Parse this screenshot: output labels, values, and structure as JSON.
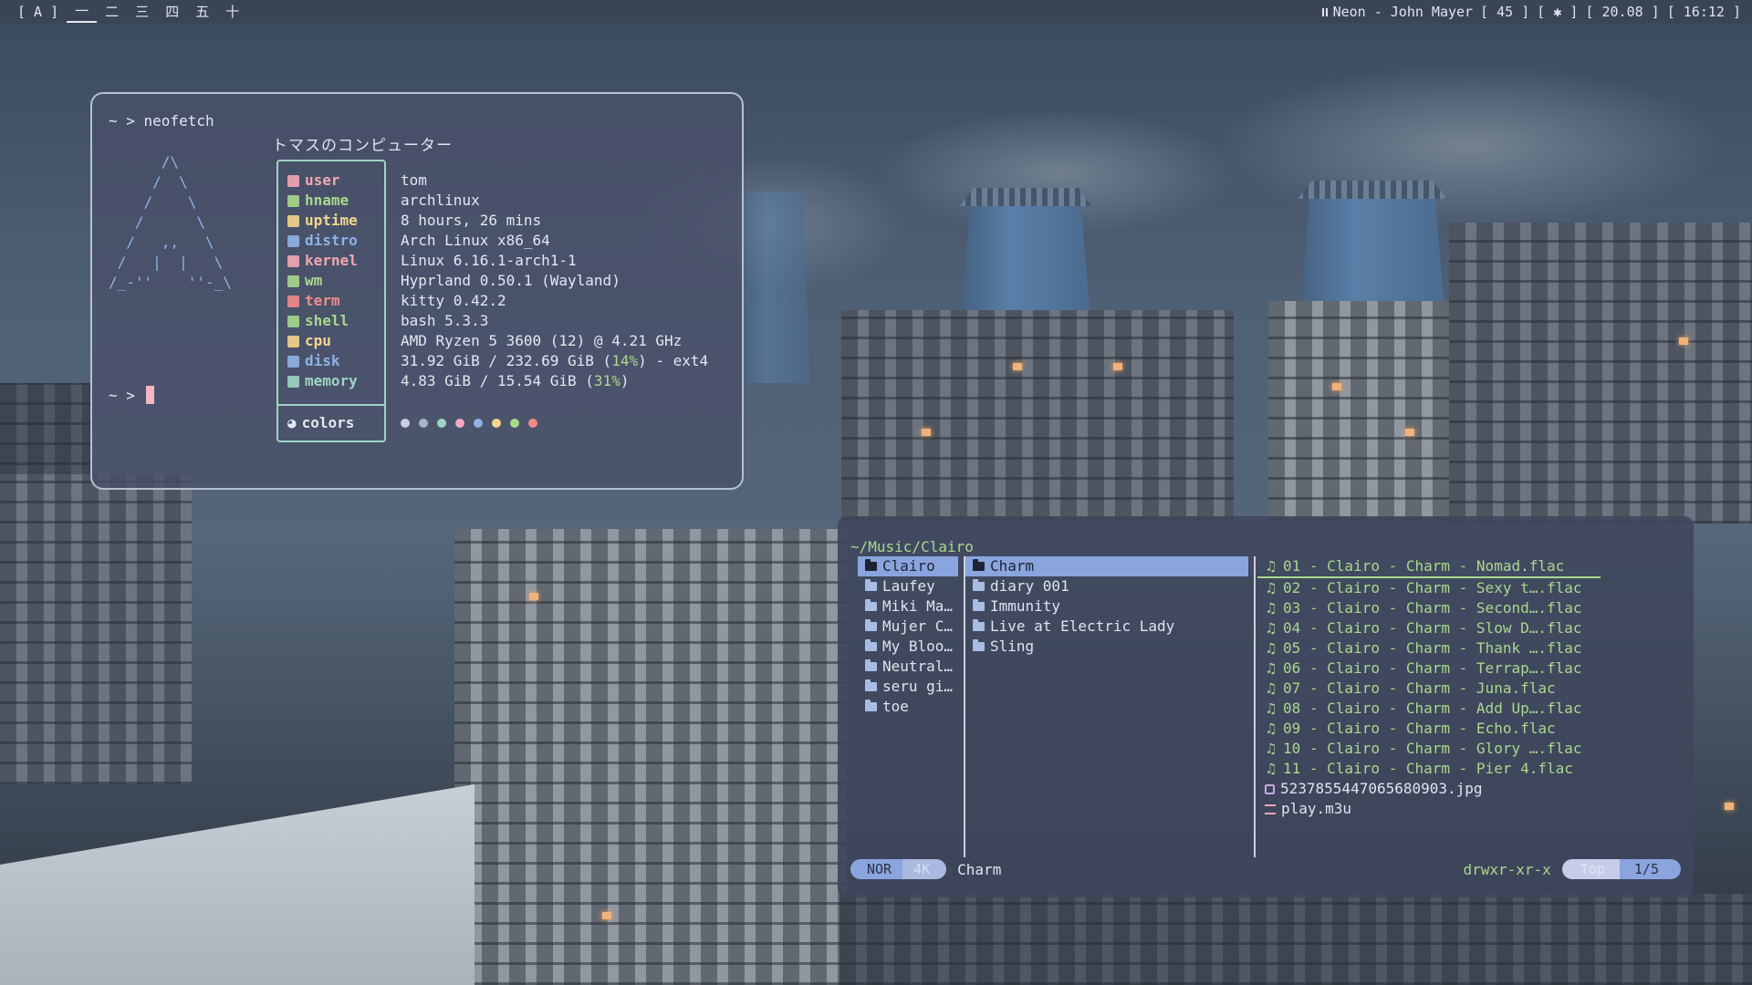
{
  "topbar": {
    "layout": "[ A ]",
    "workspaces": [
      "一",
      "二",
      "三",
      "四",
      "五",
      "十"
    ],
    "active_workspace": "一",
    "now_playing": "Neon - John Mayer",
    "volume": "[ 45 ]",
    "bluetooth": "[ ✱ ]",
    "date": "[ 20.08 ]",
    "time": "[ 16:12 ]"
  },
  "terminal": {
    "command_line": "~ > neofetch",
    "hostname_banner": "トマスのコンピューター",
    "ascii_logo": "      /\\\n     /  \\\n    /    \\\n   /      \\\n  /   ,,   \\\n /   |  |   \\\n/_-''    ''-_\\",
    "info": [
      {
        "key": "user",
        "icon": "user-icon",
        "color": "#f2a7b0",
        "value": "tom"
      },
      {
        "key": "hname",
        "icon": "host-icon",
        "color": "#a9d88d",
        "value": "archlinux"
      },
      {
        "key": "uptime",
        "icon": "clock-icon",
        "color": "#f4d58d",
        "value": "8 hours, 26 mins"
      },
      {
        "key": "distro",
        "icon": "arch-icon",
        "color": "#8fb2e6",
        "value": "Arch Linux x86_64"
      },
      {
        "key": "kernel",
        "icon": "gear-icon",
        "color": "#f2a7b0",
        "value": "Linux 6.16.1-arch1-1"
      },
      {
        "key": "wm",
        "icon": "keyboard-icon",
        "color": "#a9d88d",
        "value": "Hyprland 0.50.1 (Wayland)"
      },
      {
        "key": "term",
        "icon": "terminal-icon",
        "color": "#f28b8b",
        "value": "kitty 0.42.2"
      },
      {
        "key": "shell",
        "icon": "shell-icon",
        "color": "#a9d88d",
        "value": "bash 5.3.3"
      },
      {
        "key": "cpu",
        "icon": "cpu-icon",
        "color": "#f4d58d",
        "value": "AMD Ryzen 5 3600 (12) @ 4.21 GHz"
      },
      {
        "key": "disk",
        "icon": "disk-icon",
        "color": "#8fb2e6",
        "value_pre": "31.92 GiB / 232.69 GiB (",
        "value_pct": "14%",
        "value_post": ") - ext4"
      },
      {
        "key": "memory",
        "icon": "memory-icon",
        "color": "#9fd4c4",
        "value_pre": "4.83 GiB / 15.54 GiB (",
        "value_pct": "31%",
        "value_post": ")"
      }
    ],
    "colors_label": "colors",
    "color_dots": [
      "#c9cfdc",
      "#aab3c7",
      "#9fd4c4",
      "#f2a7c8",
      "#8fb2e6",
      "#f4d58d",
      "#a9d88d",
      "#f28b8b"
    ],
    "prompt": "~ >"
  },
  "file_manager": {
    "path": "~/Music/Clairo",
    "parent_dirs": [
      "Clairo",
      "Laufey",
      "Miki Ma…",
      "Mujer C…",
      "My Bloo…",
      "Neutral…",
      "seru gi…",
      "toe"
    ],
    "current_dirs": [
      "Charm",
      "diary 001",
      "Immunity",
      "Live at Electric Lady",
      "Sling"
    ],
    "preview_files": [
      "01 - Clairo - Charm - Nomad.flac",
      "02 - Clairo - Charm - Sexy t….flac",
      "03 - Clairo - Charm - Second….flac",
      "04 - Clairo - Charm - Slow D….flac",
      "05 - Clairo - Charm - Thank ….flac",
      "06 - Clairo - Charm - Terrap….flac",
      "07 - Clairo - Charm - Juna.flac",
      "08 - Clairo - Charm - Add Up….flac",
      "09 - Clairo - Charm - Echo.flac",
      "10 - Clairo - Charm - Glory ….flac",
      "11 - Clairo - Charm - Pier 4.flac"
    ],
    "preview_image": "5237855447065680903.jpg",
    "preview_playlist": "play.m3u",
    "status": {
      "mode": "NOR",
      "size": "4K",
      "selected_name": "Charm",
      "permissions": "drwxr-xr-x",
      "scroll": "Top",
      "position": "1/5"
    }
  }
}
